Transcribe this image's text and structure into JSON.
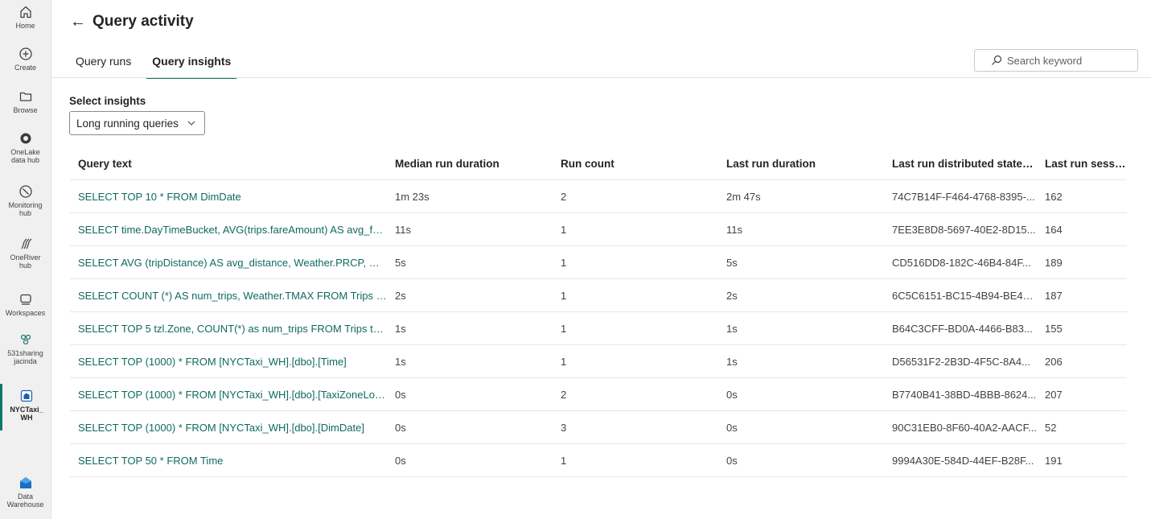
{
  "nav": {
    "items": [
      {
        "label": "Home",
        "icon": "home-icon"
      },
      {
        "label": "Create",
        "icon": "plus-circle-icon"
      },
      {
        "label": "Browse",
        "icon": "folder-icon"
      },
      {
        "label": "OneLake data hub",
        "icon": "onelake-icon"
      },
      {
        "label": "Monitoring hub",
        "icon": "monitoring-icon"
      },
      {
        "label": "OneRiver hub",
        "icon": "oneriver-icon"
      },
      {
        "label": "Workspaces",
        "icon": "workspaces-icon"
      },
      {
        "label": "531sharingjacinda",
        "icon": "workspace-group-icon"
      },
      {
        "label": "NYCTaxi_WH",
        "icon": "warehouse-icon"
      },
      {
        "label": "Data Warehouse",
        "icon": "data-warehouse-icon"
      }
    ]
  },
  "header": {
    "title": "Query activity",
    "tabs": [
      {
        "label": "Query runs",
        "active": false
      },
      {
        "label": "Query insights",
        "active": true
      }
    ],
    "search_placeholder": "Search keyword"
  },
  "insights": {
    "label": "Select insights",
    "selected": "Long running queries"
  },
  "table": {
    "columns": [
      "Query text",
      "Median run duration",
      "Run count",
      "Last run duration",
      "Last run distributed statem...",
      "Last run sessi..."
    ],
    "rows": [
      [
        "SELECT TOP 10 * FROM DimDate",
        "1m 23s",
        "2",
        "2m 47s",
        "74C7B14F-F464-4768-8395-...",
        "162"
      ],
      [
        "SELECT time.DayTimeBucket, AVG(trips.fareAmount) AS avg_far...",
        "11s",
        "1",
        "11s",
        "7EE3E8D8-5697-40E2-8D15...",
        "164"
      ],
      [
        "SELECT AVG (tripDistance) AS avg_distance, Weather.PRCP, CO...",
        "5s",
        "1",
        "5s",
        "CD516DD8-182C-46B4-84F...",
        "189"
      ],
      [
        "SELECT COUNT (*) AS num_trips, Weather.TMAX FROM Trips JO...",
        "2s",
        "1",
        "2s",
        "6C5C6151-BC15-4B94-BE4E...",
        "187"
      ],
      [
        "SELECT TOP 5 tzl.Zone, COUNT(*) as num_trips FROM Trips trip...",
        "1s",
        "1",
        "1s",
        "B64C3CFF-BD0A-4466-B83...",
        "155"
      ],
      [
        "SELECT TOP (1000) * FROM [NYCTaxi_WH].[dbo].[Time]",
        "1s",
        "1",
        "1s",
        "D56531F2-2B3D-4F5C-8A4...",
        "206"
      ],
      [
        "SELECT TOP (1000) * FROM [NYCTaxi_WH].[dbo].[TaxiZoneLook...",
        "0s",
        "2",
        "0s",
        "B7740B41-38BD-4BBB-8624...",
        "207"
      ],
      [
        "SELECT TOP (1000) * FROM [NYCTaxi_WH].[dbo].[DimDate]",
        "0s",
        "3",
        "0s",
        "90C31EB0-8F60-40A2-AACF...",
        "52"
      ],
      [
        "SELECT TOP 50 * FROM Time",
        "0s",
        "1",
        "0s",
        "9994A30E-584D-44EF-B28F...",
        "191"
      ]
    ]
  },
  "colors": {
    "accent": "#117865",
    "link": "#0f6b5c"
  }
}
